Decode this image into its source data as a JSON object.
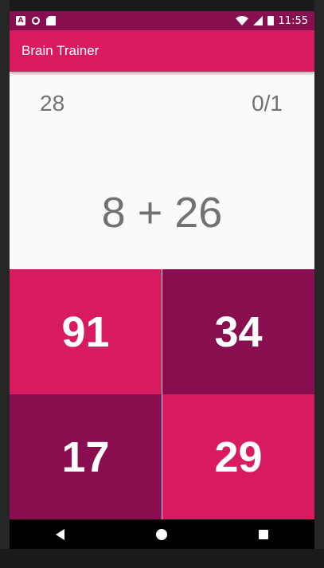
{
  "status_bar": {
    "time": "11:55",
    "notification_icons": [
      "a-icon",
      "circle-icon",
      "sd-card-icon"
    ],
    "system_icons": [
      "wifi-icon",
      "signal-icon",
      "battery-icon"
    ],
    "background_color": "#880e4f"
  },
  "app_bar": {
    "title": "Brain Trainer",
    "color": "#d81b60"
  },
  "game": {
    "timer": "28",
    "score": "0/1",
    "question": "8 + 26",
    "answers": [
      {
        "label": "91",
        "color": "#d81b60"
      },
      {
        "label": "34",
        "color": "#880e4f"
      },
      {
        "label": "17",
        "color": "#880e4f"
      },
      {
        "label": "29",
        "color": "#d81b60"
      }
    ]
  },
  "nav_bar": {
    "buttons": [
      "back-icon",
      "home-icon",
      "recents-icon"
    ]
  }
}
